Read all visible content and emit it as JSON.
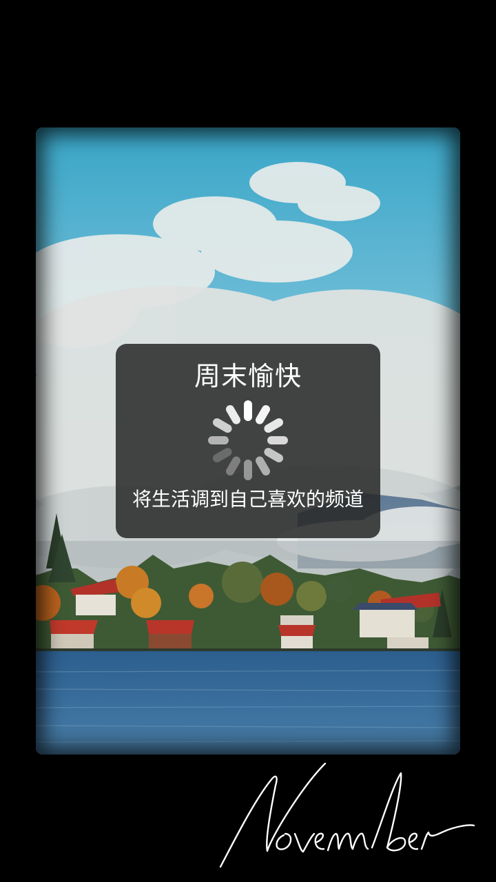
{
  "dialog": {
    "title": "周末愉快",
    "message": "将生活调到自己喜欢的频道"
  },
  "spinner": {
    "icon": "loading-spinner-icon",
    "spoke_color": "#ffffff"
  },
  "photo": {
    "icon": "lake-landscape-photo"
  },
  "signature": {
    "text": "November",
    "style": "handwritten-script"
  },
  "colors": {
    "background": "#000000",
    "dialog_background": "#282828",
    "dialog_text": "#ffffff"
  }
}
